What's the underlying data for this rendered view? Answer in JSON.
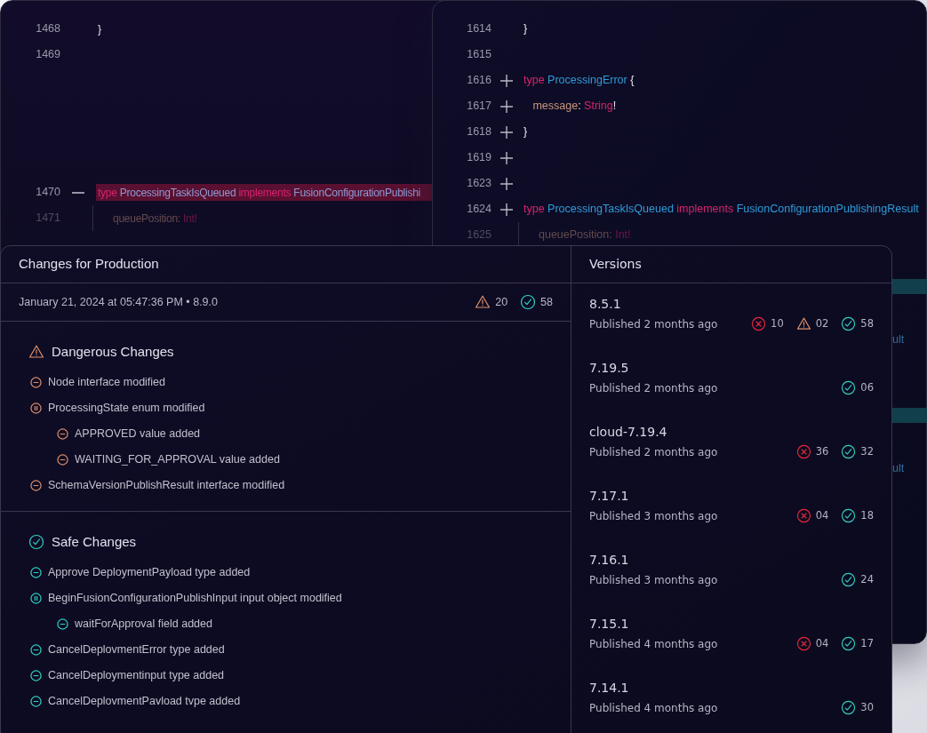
{
  "left_code": {
    "lines": [
      {
        "number": "1468",
        "kind": "context",
        "highlighted": false,
        "dimmed": false,
        "guide": false,
        "tokens": [
          {
            "kind": "punct",
            "text": "}"
          }
        ]
      },
      {
        "number": "1469",
        "kind": "context",
        "highlighted": false,
        "dimmed": false,
        "guide": false
      },
      {
        "number": "1470",
        "kind": "removed",
        "highlighted": true,
        "dimmed": false,
        "guide": false,
        "tokens": [
          {
            "kind": "keyword",
            "text": "type "
          },
          {
            "kind": "name",
            "text": "ProcessingTaskIsQueued "
          },
          {
            "kind": "keyword",
            "text": "implements "
          },
          {
            "kind": "name",
            "text": "FusionConfigurationPublishi"
          }
        ]
      },
      {
        "number": "1471",
        "kind": "context",
        "highlighted": false,
        "dimmed": true,
        "guide": true,
        "tokens": [
          {
            "kind": "field",
            "text": "queuePosition: "
          },
          {
            "kind": "keyword",
            "text": "Int!"
          }
        ]
      }
    ]
  },
  "right_code": {
    "lines": [
      {
        "number": "1614",
        "kind": "context",
        "highlighted": false,
        "dimmed": false,
        "guide": false,
        "tokens": [
          {
            "kind": "punct",
            "text": "}"
          }
        ]
      },
      {
        "number": "1615",
        "kind": "context",
        "highlighted": false,
        "dimmed": false,
        "guide": false
      },
      {
        "number": "1616",
        "kind": "added",
        "highlighted": false,
        "dimmed": false,
        "guide": false,
        "tokens": [
          {
            "kind": "keyword",
            "text": "type "
          },
          {
            "kind": "type",
            "text": "ProcessingError "
          },
          {
            "kind": "punct",
            "text": "{"
          }
        ]
      },
      {
        "number": "1617",
        "kind": "added",
        "highlighted": false,
        "dimmed": false,
        "guide": false,
        "tokens": [
          {
            "kind": "field",
            "text": "   message"
          },
          {
            "kind": "punct",
            "text": ": "
          },
          {
            "kind": "keyword",
            "text": "String"
          },
          {
            "kind": "punct",
            "text": "!"
          }
        ]
      },
      {
        "number": "1618",
        "kind": "added",
        "highlighted": false,
        "dimmed": false,
        "guide": false,
        "tokens": [
          {
            "kind": "punct",
            "text": "}"
          }
        ]
      },
      {
        "number": "1619",
        "kind": "added",
        "highlighted": false,
        "dimmed": false,
        "guide": false
      },
      {
        "number": "1623",
        "kind": "added",
        "highlighted": false,
        "dimmed": false,
        "guide": false
      },
      {
        "number": "1624",
        "kind": "added",
        "highlighted": false,
        "dimmed": false,
        "guide": false,
        "tokens": [
          {
            "kind": "keyword",
            "text": "type "
          },
          {
            "kind": "type",
            "text": "ProcessingTaskIsQueued "
          },
          {
            "kind": "keyword",
            "text": "implements "
          },
          {
            "kind": "type",
            "text": "FusionConfigurationPublishingResult"
          }
        ]
      },
      {
        "number": "1625",
        "kind": "context",
        "highlighted": false,
        "dimmed": true,
        "guide": true,
        "tokens": [
          {
            "kind": "field",
            "text": "queuePosition: "
          },
          {
            "kind": "keyword",
            "text": "Int!"
          }
        ]
      }
    ],
    "cut_off_lines": [
      {
        "text": "ult"
      },
      {
        "text": "ult"
      }
    ]
  },
  "changes": {
    "title": "Changes for Production",
    "summary": "January 21, 2024 at 05:47:36 PM • 8.9.0",
    "counts": [
      {
        "kind": "dangerous",
        "count": "20"
      },
      {
        "kind": "safe",
        "count": "58"
      }
    ],
    "sections": [
      {
        "kind": "dangerous",
        "title": "Dangerous Changes",
        "items": [
          {
            "text": "Node interface modified"
          },
          {
            "text": "ProcessingState enum modified",
            "children": [
              {
                "text": "APPROVED value added"
              },
              {
                "text": "WAITING_FOR_APPROVAL value added"
              }
            ]
          },
          {
            "text": "SchemaVersionPublishResult interface modified"
          }
        ]
      },
      {
        "kind": "safe",
        "title": "Safe Changes",
        "items": [
          {
            "text": "Approve DeploymentPayload type added"
          },
          {
            "text": "BeginFusionConfigurationPublishInput input object modified",
            "children": [
              {
                "text": "waitForApproval field added"
              }
            ]
          },
          {
            "text": "CancelDeplovmentError type added"
          },
          {
            "text": "CancelDeploymentinput type added"
          },
          {
            "text": "CancelDeplovmentPavload tvpe added"
          }
        ]
      }
    ]
  },
  "versions": {
    "title": "Versions",
    "items": [
      {
        "name": "8.5.1",
        "published": "Published 2 months ago",
        "counts": [
          {
            "kind": "breaking",
            "count": "10"
          },
          {
            "kind": "dangerous",
            "count": "02"
          },
          {
            "kind": "safe",
            "count": "58"
          }
        ]
      },
      {
        "name": "7.19.5",
        "published": "Published 2 months ago",
        "counts": [
          {
            "kind": "safe",
            "count": "06"
          }
        ]
      },
      {
        "name": "cloud-7.19.4",
        "published": "Published 2 months ago",
        "counts": [
          {
            "kind": "breaking",
            "count": "36"
          },
          {
            "kind": "safe",
            "count": "32"
          }
        ]
      },
      {
        "name": "7.17.1",
        "published": "Published 3 months ago",
        "counts": [
          {
            "kind": "breaking",
            "count": "04"
          },
          {
            "kind": "safe",
            "count": "18"
          }
        ]
      },
      {
        "name": "7.16.1",
        "published": "Published 3 months ago",
        "counts": [
          {
            "kind": "safe",
            "count": "24"
          }
        ]
      },
      {
        "name": "7.15.1",
        "published": "Published 4 months ago",
        "counts": [
          {
            "kind": "breaking",
            "count": "04"
          },
          {
            "kind": "safe",
            "count": "17"
          }
        ]
      },
      {
        "name": "7.14.1",
        "published": "Published 4 months ago",
        "counts": [
          {
            "kind": "safe",
            "count": "30"
          }
        ]
      }
    ]
  }
}
